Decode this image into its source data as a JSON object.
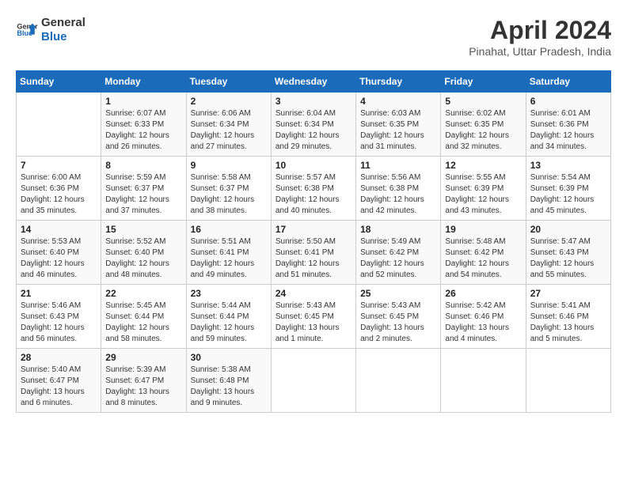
{
  "header": {
    "logo_line1": "General",
    "logo_line2": "Blue",
    "title": "April 2024",
    "subtitle": "Pinahat, Uttar Pradesh, India"
  },
  "columns": [
    "Sunday",
    "Monday",
    "Tuesday",
    "Wednesday",
    "Thursday",
    "Friday",
    "Saturday"
  ],
  "weeks": [
    [
      {
        "day": "",
        "info": ""
      },
      {
        "day": "1",
        "info": "Sunrise: 6:07 AM\nSunset: 6:33 PM\nDaylight: 12 hours\nand 26 minutes."
      },
      {
        "day": "2",
        "info": "Sunrise: 6:06 AM\nSunset: 6:34 PM\nDaylight: 12 hours\nand 27 minutes."
      },
      {
        "day": "3",
        "info": "Sunrise: 6:04 AM\nSunset: 6:34 PM\nDaylight: 12 hours\nand 29 minutes."
      },
      {
        "day": "4",
        "info": "Sunrise: 6:03 AM\nSunset: 6:35 PM\nDaylight: 12 hours\nand 31 minutes."
      },
      {
        "day": "5",
        "info": "Sunrise: 6:02 AM\nSunset: 6:35 PM\nDaylight: 12 hours\nand 32 minutes."
      },
      {
        "day": "6",
        "info": "Sunrise: 6:01 AM\nSunset: 6:36 PM\nDaylight: 12 hours\nand 34 minutes."
      }
    ],
    [
      {
        "day": "7",
        "info": "Sunrise: 6:00 AM\nSunset: 6:36 PM\nDaylight: 12 hours\nand 35 minutes."
      },
      {
        "day": "8",
        "info": "Sunrise: 5:59 AM\nSunset: 6:37 PM\nDaylight: 12 hours\nand 37 minutes."
      },
      {
        "day": "9",
        "info": "Sunrise: 5:58 AM\nSunset: 6:37 PM\nDaylight: 12 hours\nand 38 minutes."
      },
      {
        "day": "10",
        "info": "Sunrise: 5:57 AM\nSunset: 6:38 PM\nDaylight: 12 hours\nand 40 minutes."
      },
      {
        "day": "11",
        "info": "Sunrise: 5:56 AM\nSunset: 6:38 PM\nDaylight: 12 hours\nand 42 minutes."
      },
      {
        "day": "12",
        "info": "Sunrise: 5:55 AM\nSunset: 6:39 PM\nDaylight: 12 hours\nand 43 minutes."
      },
      {
        "day": "13",
        "info": "Sunrise: 5:54 AM\nSunset: 6:39 PM\nDaylight: 12 hours\nand 45 minutes."
      }
    ],
    [
      {
        "day": "14",
        "info": "Sunrise: 5:53 AM\nSunset: 6:40 PM\nDaylight: 12 hours\nand 46 minutes."
      },
      {
        "day": "15",
        "info": "Sunrise: 5:52 AM\nSunset: 6:40 PM\nDaylight: 12 hours\nand 48 minutes."
      },
      {
        "day": "16",
        "info": "Sunrise: 5:51 AM\nSunset: 6:41 PM\nDaylight: 12 hours\nand 49 minutes."
      },
      {
        "day": "17",
        "info": "Sunrise: 5:50 AM\nSunset: 6:41 PM\nDaylight: 12 hours\nand 51 minutes."
      },
      {
        "day": "18",
        "info": "Sunrise: 5:49 AM\nSunset: 6:42 PM\nDaylight: 12 hours\nand 52 minutes."
      },
      {
        "day": "19",
        "info": "Sunrise: 5:48 AM\nSunset: 6:42 PM\nDaylight: 12 hours\nand 54 minutes."
      },
      {
        "day": "20",
        "info": "Sunrise: 5:47 AM\nSunset: 6:43 PM\nDaylight: 12 hours\nand 55 minutes."
      }
    ],
    [
      {
        "day": "21",
        "info": "Sunrise: 5:46 AM\nSunset: 6:43 PM\nDaylight: 12 hours\nand 56 minutes."
      },
      {
        "day": "22",
        "info": "Sunrise: 5:45 AM\nSunset: 6:44 PM\nDaylight: 12 hours\nand 58 minutes."
      },
      {
        "day": "23",
        "info": "Sunrise: 5:44 AM\nSunset: 6:44 PM\nDaylight: 12 hours\nand 59 minutes."
      },
      {
        "day": "24",
        "info": "Sunrise: 5:43 AM\nSunset: 6:45 PM\nDaylight: 13 hours\nand 1 minute."
      },
      {
        "day": "25",
        "info": "Sunrise: 5:43 AM\nSunset: 6:45 PM\nDaylight: 13 hours\nand 2 minutes."
      },
      {
        "day": "26",
        "info": "Sunrise: 5:42 AM\nSunset: 6:46 PM\nDaylight: 13 hours\nand 4 minutes."
      },
      {
        "day": "27",
        "info": "Sunrise: 5:41 AM\nSunset: 6:46 PM\nDaylight: 13 hours\nand 5 minutes."
      }
    ],
    [
      {
        "day": "28",
        "info": "Sunrise: 5:40 AM\nSunset: 6:47 PM\nDaylight: 13 hours\nand 6 minutes."
      },
      {
        "day": "29",
        "info": "Sunrise: 5:39 AM\nSunset: 6:47 PM\nDaylight: 13 hours\nand 8 minutes."
      },
      {
        "day": "30",
        "info": "Sunrise: 5:38 AM\nSunset: 6:48 PM\nDaylight: 13 hours\nand 9 minutes."
      },
      {
        "day": "",
        "info": ""
      },
      {
        "day": "",
        "info": ""
      },
      {
        "day": "",
        "info": ""
      },
      {
        "day": "",
        "info": ""
      }
    ]
  ]
}
